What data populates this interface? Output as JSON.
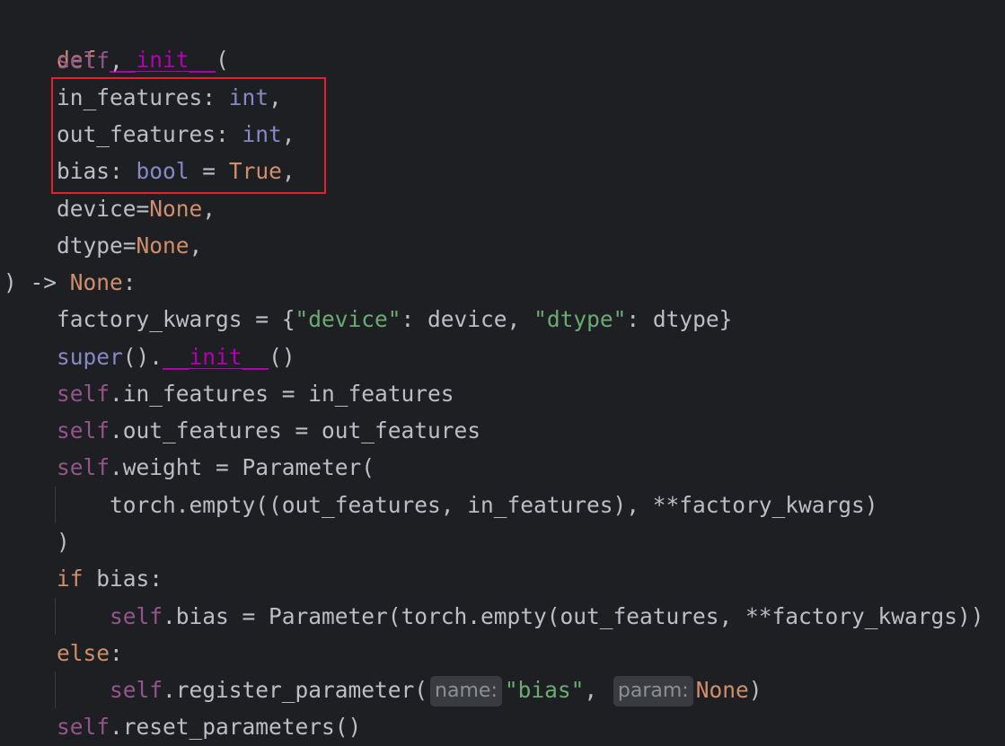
{
  "code": {
    "l1": {
      "def": "def",
      "name": "__init__",
      "open": "("
    },
    "l2": {
      "self": "self",
      "rest": ","
    },
    "l3": {
      "param": "in_features: ",
      "type": "int",
      "rest": ","
    },
    "l4": {
      "param": "out_features: ",
      "type": "int",
      "rest": ","
    },
    "l5": {
      "param": "bias: ",
      "type": "bool",
      "eq": " = ",
      "value": "True",
      "rest": ","
    },
    "l6": {
      "param": "device=",
      "value": "None",
      "rest": ","
    },
    "l7": {
      "param": "dtype=",
      "value": "None",
      "rest": ","
    },
    "l8": {
      "close": ") -> ",
      "value": "None",
      "rest": ":"
    },
    "l9": {
      "a": "factory_kwargs = {",
      "s1": "\"device\"",
      "b": ": device, ",
      "s2": "\"dtype\"",
      "c": ": dtype}"
    },
    "l10": {
      "super": "super",
      "a": "().",
      "init": "__init__",
      "b": "()"
    },
    "l11": {
      "self": "self",
      "rest": ".in_features = in_features"
    },
    "l12": {
      "self": "self",
      "rest": ".out_features = out_features"
    },
    "l13": {
      "self": "self",
      "rest": ".weight = Parameter("
    },
    "l14": {
      "rest": "torch.empty((out_features, in_features), **factory_kwargs)"
    },
    "l15": {
      "rest": ")"
    },
    "l16": {
      "kw": "if",
      "rest": " bias:"
    },
    "l17": {
      "self": "self",
      "rest": ".bias = Parameter(torch.empty(out_features, **factory_kwargs))"
    },
    "l18": {
      "kw": "else",
      "rest": ":"
    },
    "l19": {
      "self": "self",
      "a": ".register_parameter(",
      "hint1": "name:",
      "s1": "\"bias\"",
      "b": ",",
      "hint2": "param:",
      "value": "None",
      "c": ")"
    },
    "l20": {
      "self": "self",
      "rest": ".reset_parameters()"
    }
  },
  "colors": {
    "background": "#1e1f22",
    "keyword": "#cf8e6d",
    "dunder": "#b200b2",
    "self": "#94558d",
    "builtin_type": "#8888c6",
    "string": "#6aab73",
    "text": "#bcbec4",
    "highlight_box": "#e3212d"
  }
}
